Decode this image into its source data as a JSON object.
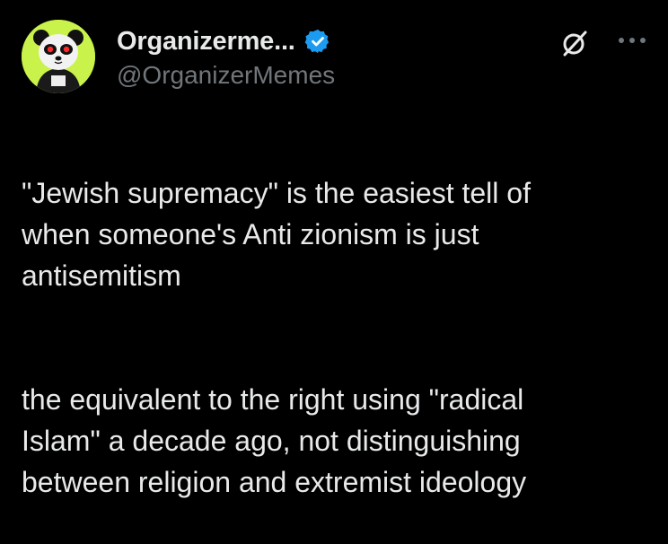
{
  "author": {
    "display_name": "Organizerme...",
    "handle": "@OrganizerMemes",
    "verified": true,
    "verified_color": "#1d9bf0",
    "avatar_background": "#c9f24a"
  },
  "actions": {
    "grok_icon": "grok-icon",
    "more_icon": "more-options-icon"
  },
  "tweet": {
    "paragraphs": [
      "\"Jewish supremacy\" is the easiest tell of\nwhen someone's Anti zionism is just\nantisemitism",
      "the equivalent to the right using \"radical\nIslam\" a decade ago, not distinguishing\nbetween religion and extremist ideology"
    ]
  },
  "colors": {
    "background": "#000000",
    "text_primary": "#e7e9ea",
    "text_secondary": "#71767b"
  }
}
